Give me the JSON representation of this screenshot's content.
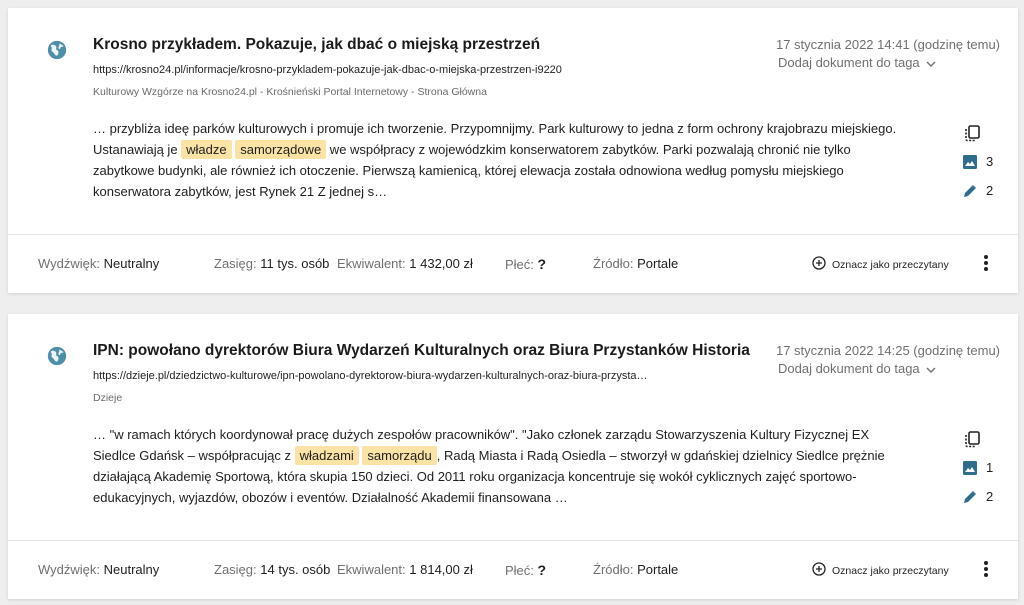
{
  "items": [
    {
      "title": "Krosno przykładem. Pokazuje, jak dbać o miejską przestrzeń",
      "url": "https://krosno24.pl/informacje/krosno-przykladem-pokazuje-jak-dbac-o-miejska-przestrzen-i9220",
      "source": "Kulturowy Wzgórze na Krosno24.pl - Krośnieński Portal Internetowy - Strona Główna",
      "date": "17 stycznia 2022 14:41 (godzinę temu)",
      "tag_label": "Dodaj dokument do taga",
      "snippet": {
        "before": "… przybliża ideę parków kulturowych i promuje ich tworzenie. Przypomnijmy. Park kulturowy to jedna z form ochrony krajobrazu miejskiego. Ustanawiają je ",
        "hl1": "władze",
        "hl2": "samorządowe",
        "after": " we współpracy z wojewódzkim konserwatorem zabytków. Parki pozwalają chronić nie tylko zabytkowe budynki, ale również ich otoczenie. Pierwszą kamienicą, której elewacja została odnowiona według pomysłu miejskiego konserwatora zabytków, jest Rynek 21 Z jednej s…"
      },
      "images_count": "3",
      "edits_count": "2",
      "footer": {
        "sentiment_label": "Wydźwięk:",
        "sentiment_value": "Neutralny",
        "reach_label": "Zasięg:",
        "reach_value": "11 tys. osób",
        "equiv_label": "Ekwiwalent:",
        "equiv_value": "1 432,00 zł",
        "gender_label": "Płeć:",
        "gender_value": "?",
        "source_label": "Źródło:",
        "source_value": "Portale",
        "mark_read_label": "Oznacz jako przeczytany"
      }
    },
    {
      "title": "IPN: powołano dyrektorów Biura Wydarzeń Kulturalnych oraz Biura Przystanków Historia",
      "url": "https://dzieje.pl/dziedzictwo-kulturowe/ipn-powolano-dyrektorow-biura-wydarzen-kulturalnych-oraz-biura-przysta…",
      "source": "Dzieje",
      "date": "17 stycznia 2022 14:25 (godzinę temu)",
      "tag_label": "Dodaj dokument do taga",
      "snippet": {
        "before": "… \"w ramach których koordynował pracę dużych zespołów pracowników\". \"Jako członek zarządu Stowarzyszenia Kultury Fizycznej EX Siedlce Gdańsk – współpracując z ",
        "hl1": "władzami",
        "hl2": "samorządu",
        "after": ", Radą Miasta i Radą Osiedla – stworzył w gdańskiej dzielnicy Siedlce prężnie działającą Akademię Sportową, która skupia 150 dzieci. Od 2011 roku organizacja koncentruje się wokół cyklicznych zajęć sportowo-edukacyjnych, wyjazdów, obozów i eventów. Działalność Akademii finansowana …"
      },
      "images_count": "1",
      "edits_count": "2",
      "footer": {
        "sentiment_label": "Wydźwięk:",
        "sentiment_value": "Neutralny",
        "reach_label": "Zasięg:",
        "reach_value": "14 tys. osób",
        "equiv_label": "Ekwiwalent:",
        "equiv_value": "1 814,00 zł",
        "gender_label": "Płeć:",
        "gender_value": "?",
        "source_label": "Źródło:",
        "source_value": "Portale",
        "mark_read_label": "Oznacz jako przeczytany"
      }
    }
  ],
  "colors": {
    "globe": "#4e8fa8",
    "side_icon": "#2e6c8c",
    "highlight": "#fbe3a6"
  }
}
